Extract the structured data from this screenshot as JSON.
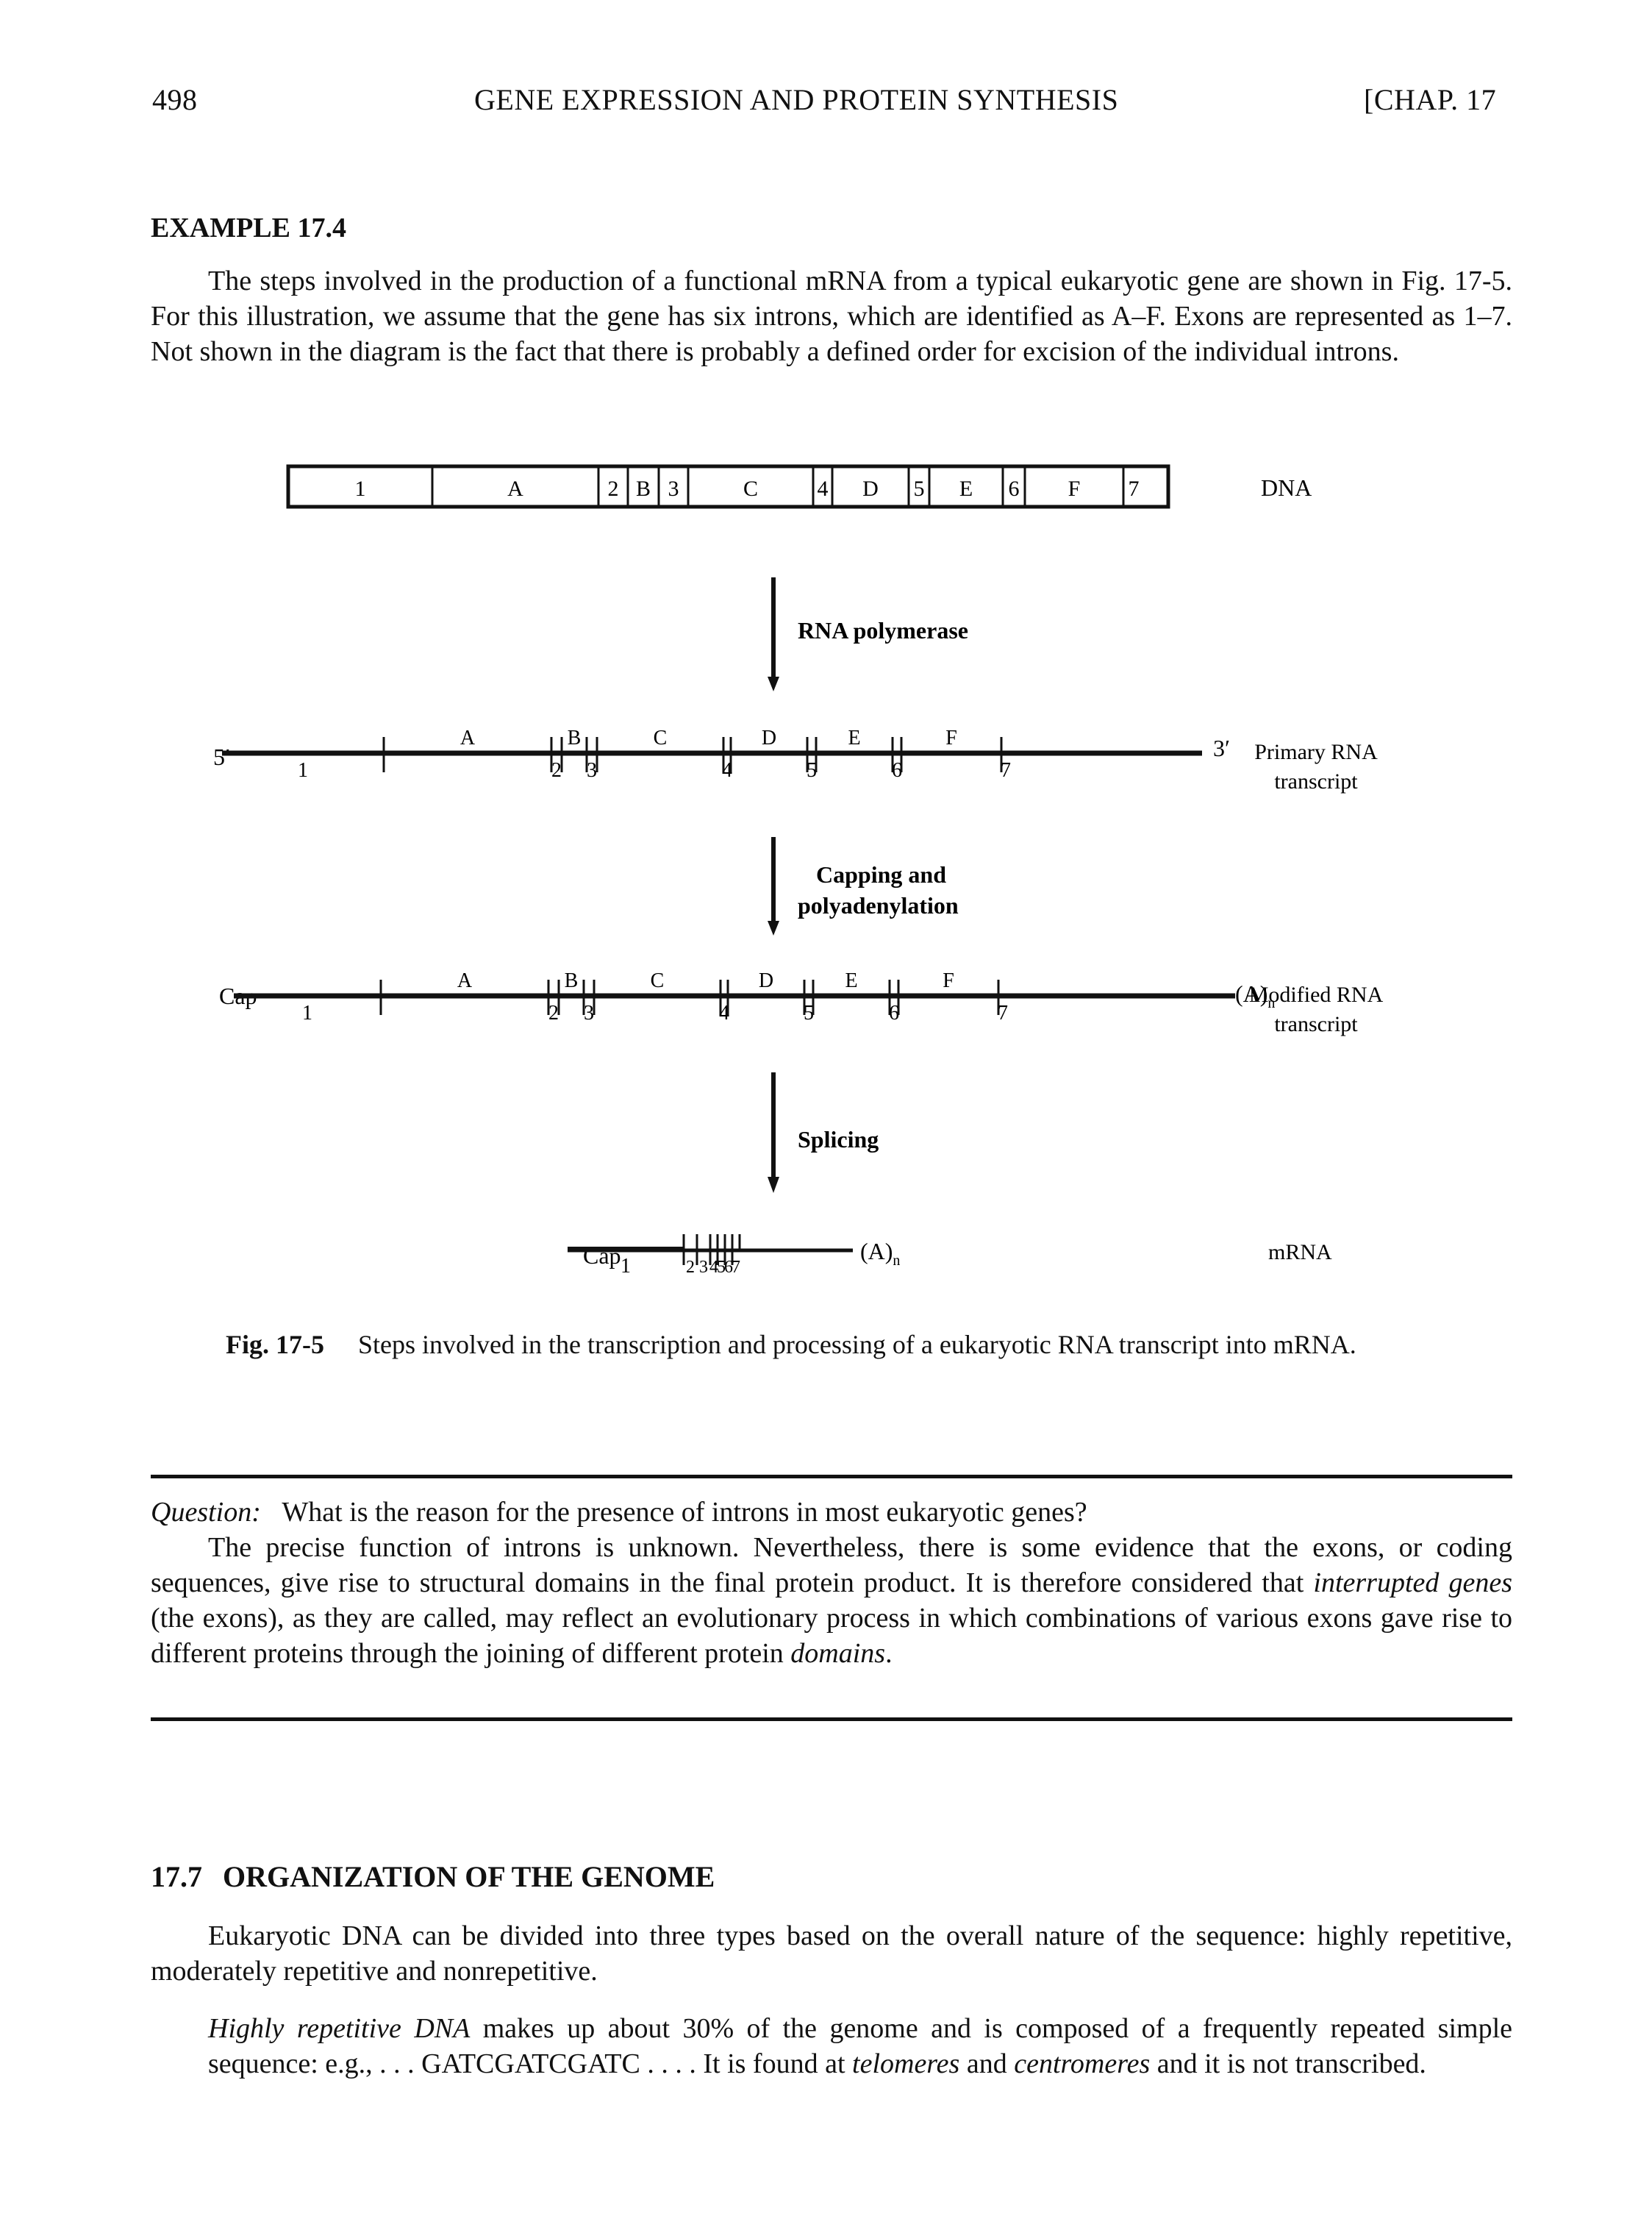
{
  "header": {
    "page_number": "498",
    "running_title": "GENE EXPRESSION AND PROTEIN SYNTHESIS",
    "chapter": "[CHAP. 17"
  },
  "example": {
    "title": "EXAMPLE 17.4",
    "body": "The steps involved in the production of a functional mRNA from a typical eukaryotic gene are shown in Fig. 17-5. For this illustration, we assume that the gene has six introns, which are identified as A–F. Exons are represented as 1–7. Not shown in the diagram is the fact that there is probably a defined order for excision of the individual introns."
  },
  "figure": {
    "dna_segments": [
      {
        "label": "1",
        "type": "exon"
      },
      {
        "label": "A",
        "type": "intron"
      },
      {
        "label": "2",
        "type": "exon"
      },
      {
        "label": "B",
        "type": "intron"
      },
      {
        "label": "3",
        "type": "exon"
      },
      {
        "label": "C",
        "type": "intron"
      },
      {
        "label": "4",
        "type": "exon"
      },
      {
        "label": "D",
        "type": "intron"
      },
      {
        "label": "5",
        "type": "exon"
      },
      {
        "label": "E",
        "type": "intron"
      },
      {
        "label": "6",
        "type": "exon"
      },
      {
        "label": "F",
        "type": "intron"
      },
      {
        "label": "7",
        "type": "exon"
      }
    ],
    "row_labels": {
      "dna": "DNA",
      "primary_line1": "Primary RNA",
      "primary_line2": "transcript",
      "modified_line1": "Modified RNA",
      "modified_line2": "transcript",
      "mrna": "mRNA"
    },
    "steps": {
      "step1": "RNA polymerase",
      "step2_line1": "Capping and",
      "step2_line2": "polyadenylation",
      "step3": "Splicing"
    },
    "ends": {
      "five_prime": "5′",
      "three_prime": "3′",
      "cap": "Cap",
      "poly_a": "(A)",
      "poly_a_sub": "n"
    },
    "caption_label": "Fig. 17-5",
    "caption_text": "Steps involved in the transcription and processing of a eukaryotic RNA transcript into mRNA."
  },
  "question": {
    "label": "Question:",
    "text": "What is the reason for the presence of introns in most eukaryotic genes?",
    "answer_part1": "The precise function of introns is unknown. Nevertheless, there is some evidence that the exons, or coding sequences, give rise to structural domains in the final protein product. It is therefore considered that ",
    "answer_em1": "interrupted genes",
    "answer_part2": " (the exons), as they are called, may reflect an evolutionary process in which combinations of various exons gave rise to different proteins through the joining of different protein ",
    "answer_em2": "domains",
    "answer_part3": "."
  },
  "section": {
    "number": "17.7",
    "title": "ORGANIZATION OF THE GENOME",
    "para1": "Eukaryotic DNA can be divided into three types based on the overall nature of the sequence: highly repetitive, moderately repetitive and nonrepetitive.",
    "para2_em1": "Highly repetitive DNA",
    "para2_part1": " makes up about 30% of the genome and is composed of a frequently repeated simple sequence: e.g., . . . GATCGATCGATC . . . . It is found at ",
    "para2_em2": "telomeres",
    "para2_part2": " and ",
    "para2_em3": "centromeres",
    "para2_part3": " and it is not transcribed."
  }
}
